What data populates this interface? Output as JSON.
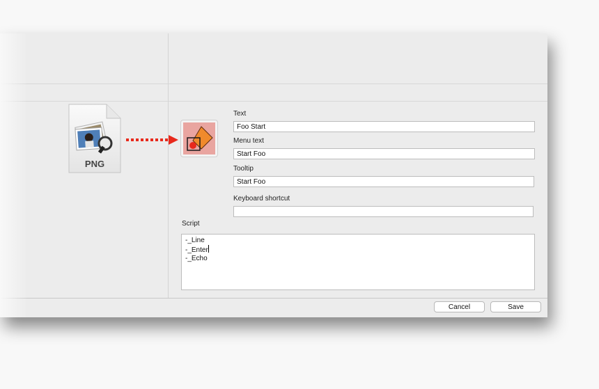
{
  "file_icon": {
    "type_label": "PNG"
  },
  "form": {
    "text": {
      "label": "Text",
      "value": "Foo Start"
    },
    "menu_text": {
      "label": "Menu text",
      "value": "Start Foo"
    },
    "tooltip": {
      "label": "Tooltip",
      "value": "Start Foo"
    },
    "keyboard_shortcut": {
      "label": "Keyboard shortcut",
      "value": ""
    },
    "script": {
      "label": "Script",
      "lines": [
        "-_Line",
        "-_Enter",
        "-_Echo"
      ]
    }
  },
  "buttons": {
    "cancel": "Cancel",
    "save": "Save"
  },
  "colors": {
    "arrow": "#e8291c",
    "icon_bg": "#e9a5a0",
    "diamond": "#f08a2c"
  }
}
